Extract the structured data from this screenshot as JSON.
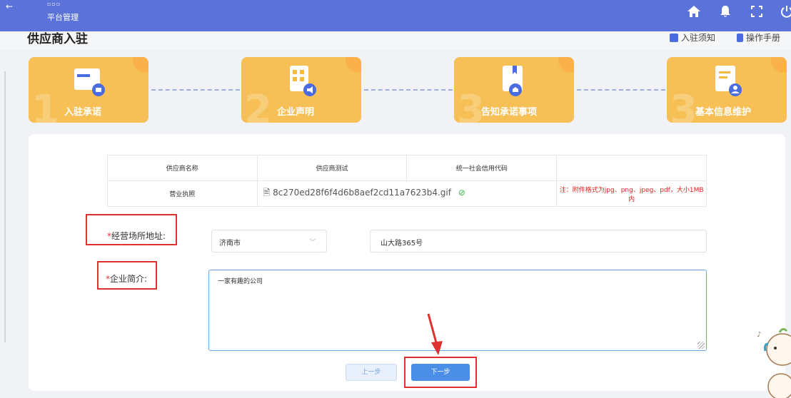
{
  "topbar": {
    "back_glyph": "←",
    "small_text": "▫▫▫",
    "crumb": "平台管理",
    "icons": [
      "home-icon",
      "bell-icon",
      "fullscreen-icon",
      "power-icon"
    ]
  },
  "header": {
    "title": "供应商入驻",
    "link_notice": "入驻须知",
    "link_manual": "操作手册"
  },
  "steps": [
    {
      "number": "1",
      "label": "入驻承诺",
      "icon": "folder-icon"
    },
    {
      "number": "2",
      "label": "企业声明",
      "icon": "building-icon"
    },
    {
      "number": "3",
      "label": "告知承诺事项",
      "icon": "book-icon"
    },
    {
      "number": "3",
      "label": "基本信息维护",
      "icon": "document-user-icon"
    }
  ],
  "info_table": {
    "supplier_name_label": "供应商名称",
    "supplier_name_value": "供应商测试",
    "credit_code_label": "统一社会信用代码",
    "credit_code_value": "",
    "license_label": "营业执照",
    "license_file": "8c270ed28f6f4d6b8aef2cd11a7623b4.gif",
    "license_note": "注：附件格式为jpg、png、jpeg、pdf，大小1MB内"
  },
  "form": {
    "address_label": "经营场所地址:",
    "city_value": "济南市",
    "address_value": "山大路365号",
    "intro_label": "企业简介:",
    "intro_value": "一家有趣的公司",
    "required_mark": "*"
  },
  "buttons": {
    "prev": "上一步",
    "next": "下一步"
  },
  "colors": {
    "topbar": "#5b73d8",
    "step_orange": "#f6ba3c",
    "primary": "#4b8ee8",
    "highlight_red": "#e03131"
  }
}
